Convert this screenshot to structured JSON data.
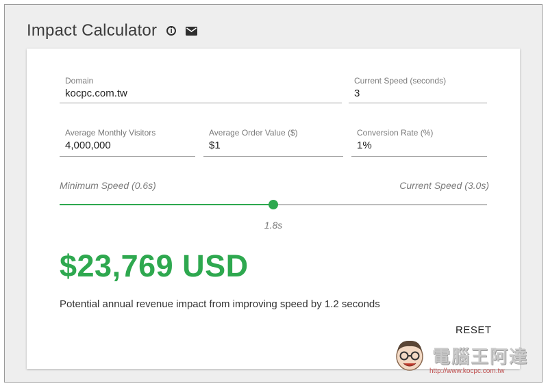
{
  "header": {
    "title": "Impact Calculator",
    "info_icon": "info-icon",
    "mail_icon": "mail-icon"
  },
  "form": {
    "domain": {
      "label": "Domain",
      "value": "kocpc.com.tw"
    },
    "current_speed": {
      "label": "Current Speed (seconds)",
      "value": "3"
    },
    "monthly_visitors": {
      "label": "Average Monthly Visitors",
      "value": "4,000,000"
    },
    "order_value": {
      "label": "Average Order Value ($)",
      "value": "$1"
    },
    "conversion_rate": {
      "label": "Conversion Rate (%)",
      "value": "1%"
    }
  },
  "slider": {
    "min_label": "Minimum Speed (0.6s)",
    "max_label": "Current Speed (3.0s)",
    "value_label": "1.8s",
    "min": 0.6,
    "max": 3.0,
    "value": 1.8
  },
  "result": {
    "amount": "$23,769 USD",
    "description": "Potential annual revenue impact from improving speed by 1.2 seconds"
  },
  "actions": {
    "reset_label": "RESET"
  },
  "watermark": {
    "text": "電腦王阿達",
    "url": "http://www.kocpc.com.tw"
  },
  "colors": {
    "accent": "#2ea84f",
    "background": "#eeeeee",
    "card": "#ffffff"
  }
}
